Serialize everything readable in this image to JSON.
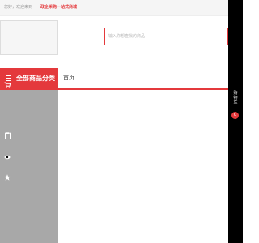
{
  "header": {
    "greeting": "您好，欢迎来到",
    "promo": "政企采购一站式商城"
  },
  "search": {
    "placeholder": "输入你想查找的商品",
    "value": ""
  },
  "nav": {
    "category_label": "全部商品分类",
    "home_label": "首页"
  },
  "toolbar": {
    "cart_chars": [
      "购",
      "物",
      "车"
    ],
    "cart_count": "0",
    "icons": [
      "user-icon",
      "cart-icon",
      "clipboard-icon",
      "eye-icon",
      "star-icon"
    ]
  },
  "colors": {
    "accent": "#e4393c",
    "toolbar": "#000000",
    "category_panel": "#a8a8a8"
  }
}
